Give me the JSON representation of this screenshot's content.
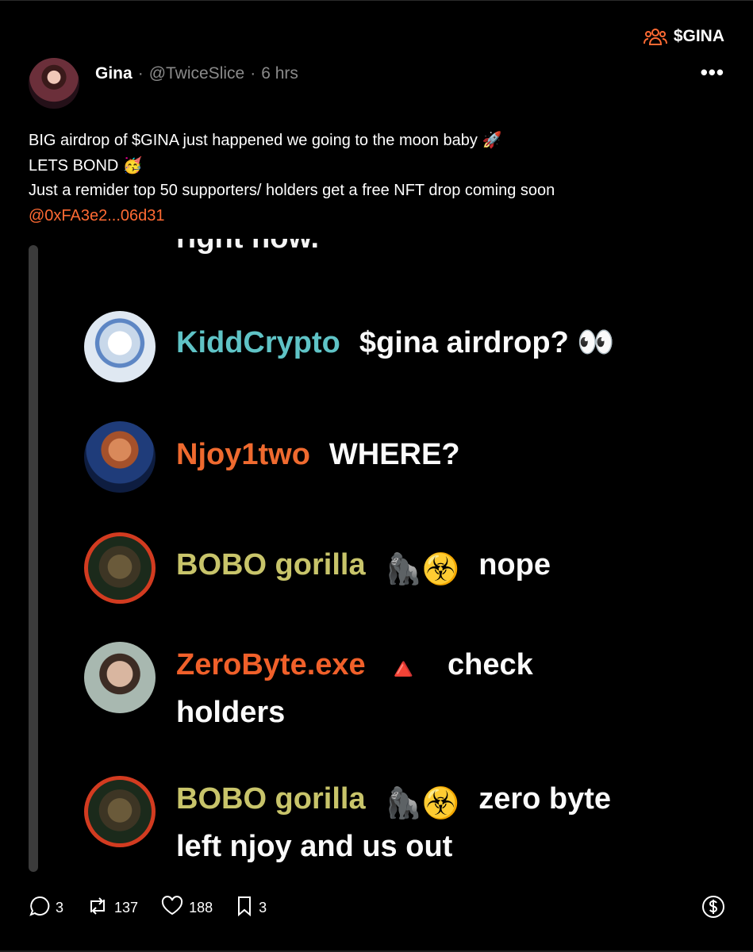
{
  "community": {
    "icon": "people-icon",
    "label": "$GINA",
    "accent": "#ff6a33"
  },
  "post": {
    "author": "Gina",
    "handle": "@TwiceSlice",
    "time": "6 hrs",
    "more_label": "•••",
    "text_lines": [
      "BIG airdrop of $GINA just happened we going to the moon baby 🚀",
      "LETS BOND 🥳",
      "Just a remider top 50 supporters/ holders get a free NFT drop coming soon"
    ],
    "mention": "@0xFA3e2...06d31"
  },
  "embed": {
    "top_fragment": "rignt now.",
    "messages": [
      {
        "user": "KiddCrypto",
        "text": "$gina airdrop? 👀",
        "color": "#5fc3c6"
      },
      {
        "user": "Njoy1two",
        "text": "WHERE?",
        "color": "#ef6a2f"
      },
      {
        "user": "BOBO gorilla",
        "badge": "🦍☣️",
        "text": "nope",
        "color": "#c8c46a"
      },
      {
        "user": "ZeroByte.exe",
        "badge": "🔺",
        "text": "check",
        "text2": "holders",
        "color": "#f0602a"
      },
      {
        "user": "BOBO gorilla",
        "badge": "🦍☣️",
        "text": "zero byte",
        "text2": "left njoy and us out",
        "color": "#c8c46a"
      }
    ]
  },
  "actions": {
    "replies": "3",
    "reposts": "137",
    "likes": "188",
    "bookmarks": "3"
  }
}
